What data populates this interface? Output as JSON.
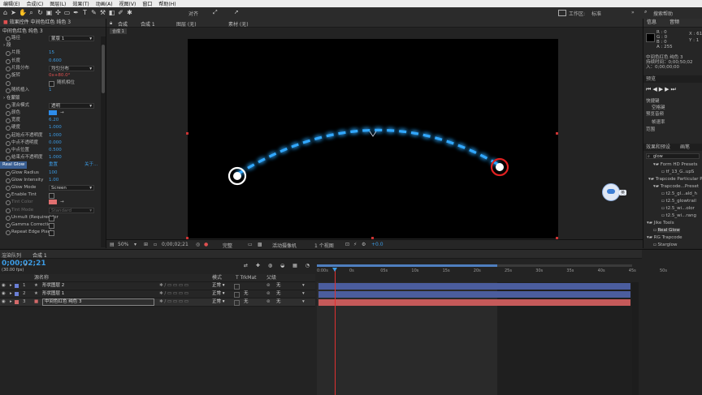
{
  "menu": [
    "编辑(E)",
    "合成(C)",
    "图层(L)",
    "效果(T)",
    "动画(A)",
    "视图(V)",
    "窗口",
    "帮助(H)"
  ],
  "toolbar": {
    "snap_label": "对齐",
    "workspace_label": "工作区:",
    "workspace_value": "标准",
    "search_placeholder": "搜索帮助"
  },
  "effect_panel": {
    "tab_label": "效果控件 中间色红色 纯色 3",
    "layer_path": "中间色红色 纯色 3",
    "rows": [
      {
        "label": "路径",
        "value": "蒙版 1",
        "kind": "dropdown"
      },
      {
        "label": "段",
        "value": "",
        "kind": "section"
      },
      {
        "label": "片段",
        "value": "15",
        "kind": "value"
      },
      {
        "label": "长度",
        "value": "0.600",
        "kind": "value"
      },
      {
        "label": "片段分布",
        "value": "均匀分布",
        "kind": "dropdown"
      },
      {
        "label": "旋转",
        "value": "0x+80.0°",
        "kind": "value-red"
      },
      {
        "label": "",
        "value": "随机相位",
        "kind": "check"
      },
      {
        "label": "随机植入",
        "value": "1",
        "kind": "value"
      },
      {
        "label": "在蒙版",
        "value": "",
        "kind": "section"
      },
      {
        "label": "混合模式",
        "value": "透明",
        "kind": "dropdown"
      },
      {
        "label": "颜色",
        "value": "",
        "kind": "color"
      },
      {
        "label": "宽度",
        "value": "6.20",
        "kind": "value"
      },
      {
        "label": "硬度",
        "value": "1.000",
        "kind": "value"
      },
      {
        "label": "起始点不透明度",
        "value": "1.000",
        "kind": "value"
      },
      {
        "label": "中点不透明度",
        "value": "0.000",
        "kind": "value"
      },
      {
        "label": "中点位置",
        "value": "0.500",
        "kind": "value"
      },
      {
        "label": "结束点不透明度",
        "value": "1.000",
        "kind": "value"
      }
    ],
    "real_glow_label": "Real Glow",
    "real_glow_reset": "重置",
    "real_glow_about": "关于...",
    "glow_rows": [
      {
        "label": "Glow Radius",
        "value": "100",
        "kind": "value"
      },
      {
        "label": "Glow Intensity",
        "value": "1.00",
        "kind": "value"
      },
      {
        "label": "Glow Mode",
        "value": "Screen",
        "kind": "dropdown"
      },
      {
        "label": "Enable Tint",
        "value": "",
        "kind": "check"
      },
      {
        "label": "Tint Color",
        "value": "",
        "kind": "color-red"
      },
      {
        "label": "Tint Mode",
        "value": "Standard",
        "kind": "dropdown-dim"
      },
      {
        "label": "Unmult (Required for",
        "value": "",
        "kind": "check"
      },
      {
        "label": "Gamma Correction",
        "value": "",
        "kind": "check"
      },
      {
        "label": "Repeat Edge Pixels",
        "value": "",
        "kind": "check"
      }
    ]
  },
  "viewer": {
    "tabs": [
      "合成",
      "合成 1",
      "图层 (无)",
      "素材 (无)"
    ],
    "active_tab": "合成 1",
    "zoom": "50%",
    "timecode": "0;00;02;21",
    "resolution": "完整",
    "camera": "活动摄像机",
    "views": "1 个视图",
    "exposure": "+0.0"
  },
  "info_panel": {
    "tabs": [
      "信息",
      "音频"
    ],
    "rgba": [
      "R : 0",
      "G : 0",
      "B : 0",
      "A : 255"
    ],
    "coords": [
      "X : 610",
      "Y : 1"
    ],
    "layer": "中间色红色 纯色 3",
    "duration": "持续时间：0;00;50;02",
    "inout": "入：0;00;00;00"
  },
  "preview_panel": {
    "title": "预览",
    "shortcut_label": "快捷键",
    "shortcut_value": "空格键",
    "preview_label": "预览音频",
    "rate_label": "帧速率",
    "range_label": "范围"
  },
  "effects_presets": {
    "title": "效果和预设",
    "tab2": "画笔",
    "search_value": "glow",
    "items": [
      "Form HD Presets",
      "tf_13_G..upS",
      "Trapcode Particular Pr",
      "Trapcode...Preset",
      "t2.5_gl...ald_h",
      "t2.5_glowtrail",
      "t2.5_wi...olor",
      "t2.5_wi...rang",
      "Jike Tools",
      "Real Glow",
      "RG Trapcode",
      "Starglow"
    ]
  },
  "align_tabs": [
    "对齐",
    "段落"
  ],
  "timeline": {
    "tabs": [
      "渲染队列",
      "合成 1"
    ],
    "timecode": "0;00;02;21",
    "fps": "(30.00 fps)",
    "col_name": "源名称",
    "col_mode": "模式",
    "col_trkmat": "T TrkMat",
    "col_parent": "父级",
    "layers": [
      {
        "num": "1",
        "name": "形状图层 2",
        "mode": "正常",
        "trk": "",
        "parent": "无",
        "color": "#6a7fd6"
      },
      {
        "num": "2",
        "name": "形状图层 1",
        "mode": "正常",
        "trk": "无",
        "parent": "无",
        "color": "#6a7fd6"
      },
      {
        "num": "3",
        "name": "中间色红色 纯色 3",
        "mode": "正常",
        "trk": "无",
        "parent": "无",
        "color": "#d46a6a"
      }
    ],
    "ruler": [
      "0:00s",
      "0s",
      "05s",
      "10s",
      "15s",
      "20s",
      "25s",
      "30s",
      "35s",
      "40s",
      "45s",
      "50s"
    ],
    "playhead_fraction": 0.057
  },
  "status_badge": "英",
  "colors": {
    "accent": "#2d8ceb",
    "glow": "#31a8ff",
    "red_circle": "#e02020",
    "layer_blue": "#4b5d9e",
    "layer_red": "#c55a5a"
  }
}
